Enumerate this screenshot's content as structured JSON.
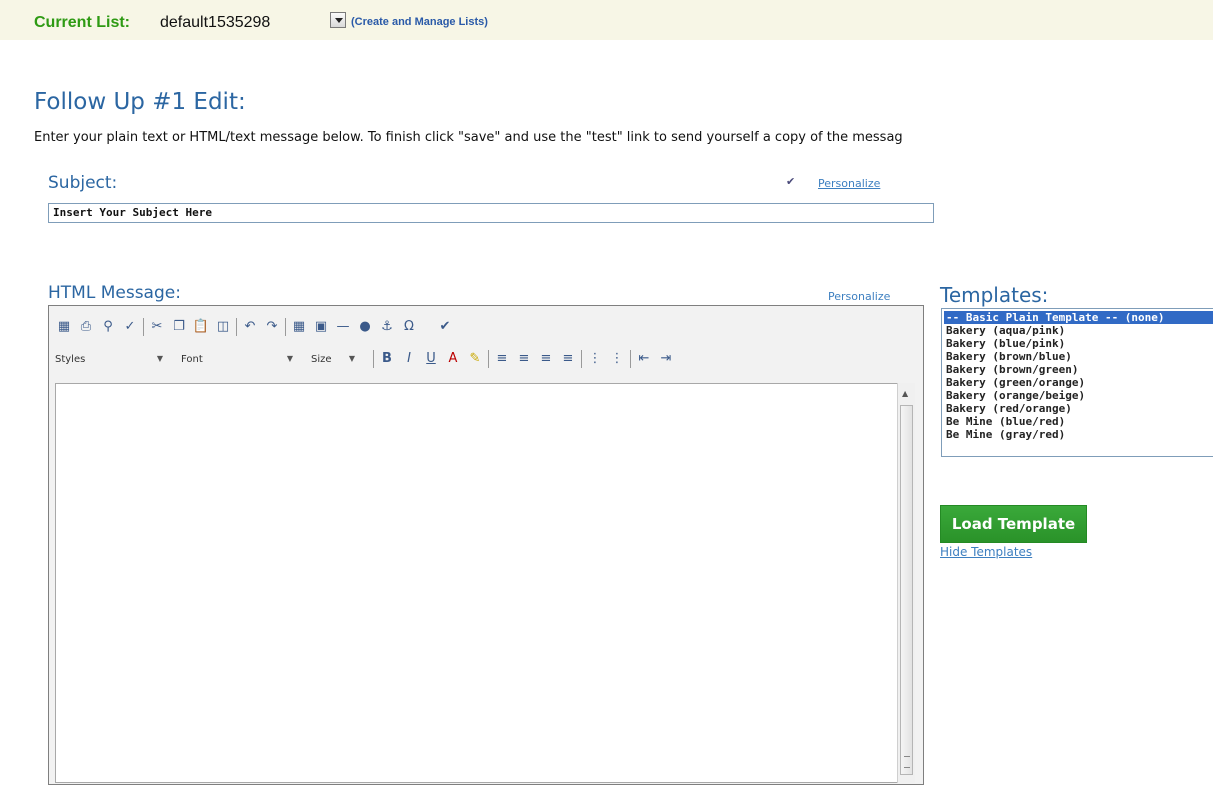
{
  "list_bar": {
    "label": "Current List:",
    "value": "default1535298",
    "manage_link": "(Create and Manage Lists)"
  },
  "page": {
    "title": "Follow Up #1 Edit:",
    "instructions": "Enter your plain text or HTML/text message below. To finish click \"save\" and use the \"test\" link to send yourself a copy of the messag"
  },
  "subject": {
    "label": "Subject:",
    "personalize": "Personalize",
    "value": "Insert Your Subject Here"
  },
  "message": {
    "label": "HTML Message:",
    "personalize": "Personalize",
    "toolbar": {
      "styles": "Styles",
      "font": "Font",
      "size": "Size"
    }
  },
  "templates": {
    "label": "Templates:",
    "items": [
      "-- Basic Plain Template -- (none)",
      "Bakery (aqua/pink)",
      "Bakery (blue/pink)",
      "Bakery (brown/blue)",
      "Bakery (brown/green)",
      "Bakery (green/orange)",
      "Bakery (orange/beige)",
      "Bakery (red/orange)",
      "Be Mine (blue/red)",
      "Be Mine (gray/red)"
    ],
    "load_button": "Load Template",
    "hide_link": "Hide Templates"
  },
  "colors": {
    "accent_blue": "#2b66a2",
    "list_label_green": "#2e9a13",
    "button_green": "#2f9a2f",
    "selection_blue": "#316ac5"
  }
}
